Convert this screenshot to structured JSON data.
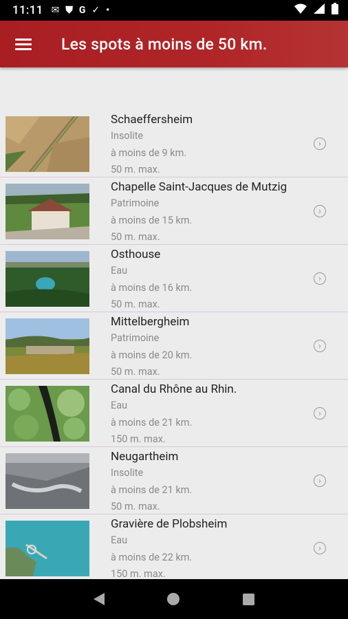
{
  "status_bar": {
    "time": "11:11",
    "icons": [
      "gmail-icon",
      "shield-icon",
      "google-icon",
      "download-done-icon",
      "dot-icon"
    ],
    "right_icons": [
      "wifi-icon",
      "signal-icon",
      "battery-icon"
    ]
  },
  "app_bar": {
    "title": "Les spots à moins de 50 km.",
    "menu_icon": "hamburger-menu-icon"
  },
  "spots": [
    {
      "name": "Schaeffersheim",
      "category": "Insolite",
      "distance": "à moins de 9 km.",
      "altitude": "50 m. max."
    },
    {
      "name": "Chapelle Saint-Jacques de Mutzig",
      "category": "Patrimoine",
      "distance": "à moins de 15 km.",
      "altitude": "50 m. max."
    },
    {
      "name": "Osthouse",
      "category": "Eau",
      "distance": "à moins de 16 km.",
      "altitude": "50 m. max."
    },
    {
      "name": "Mittelbergheim",
      "category": "Patrimoine",
      "distance": "à moins de 20 km.",
      "altitude": "50 m. max."
    },
    {
      "name": "Canal du Rhône au Rhin.",
      "category": "Eau",
      "distance": "à moins de 21 km.",
      "altitude": "150 m. max."
    },
    {
      "name": "Neugartheim",
      "category": "Insolite",
      "distance": "à moins de 21 km.",
      "altitude": "50 m. max."
    },
    {
      "name": "Gravière de Plobsheim",
      "category": "Eau",
      "distance": "à moins de 22 km.",
      "altitude": "150 m. max."
    }
  ],
  "nav_bar": {
    "buttons": [
      "back-icon",
      "home-icon",
      "recents-icon"
    ]
  },
  "colors": {
    "app_bar": "#a81e22",
    "background": "#ececec",
    "divider": "#d9c7dd"
  }
}
